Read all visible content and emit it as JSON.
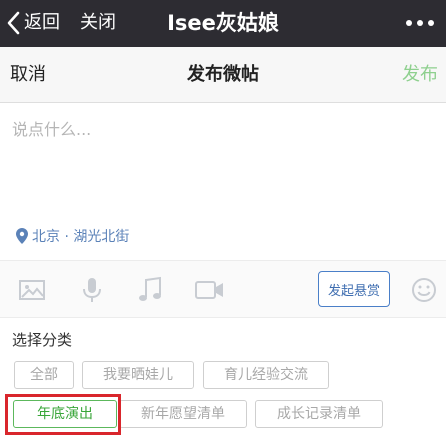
{
  "topbar": {
    "back_label": "返回",
    "close_label": "关闭",
    "title": "Isee灰姑娘"
  },
  "header": {
    "cancel_label": "取消",
    "title": "发布微帖",
    "publish_label": "发布"
  },
  "compose": {
    "placeholder": "说点什么...",
    "location": "北京 · 湖光北街"
  },
  "toolbar": {
    "bounty_label": "发起悬赏"
  },
  "categories": {
    "title": "选择分类",
    "tags": [
      {
        "label": "全部"
      },
      {
        "label": "我要晒娃儿"
      },
      {
        "label": "育儿经验交流"
      },
      {
        "label": "年底演出",
        "selected": true
      },
      {
        "label": "新年愿望清单"
      },
      {
        "label": "成长记录清单"
      }
    ]
  },
  "colors": {
    "topbar_bg": "#2d2c32",
    "publish_disabled": "#8ed08e",
    "link_blue": "#5b82b8",
    "selected_green": "#3aa63a",
    "highlight_red": "#d9262c"
  },
  "icons": [
    "chevron-left-icon",
    "more-icon",
    "location-pin-icon",
    "image-icon",
    "microphone-icon",
    "music-note-icon",
    "video-icon",
    "emoji-icon"
  ]
}
